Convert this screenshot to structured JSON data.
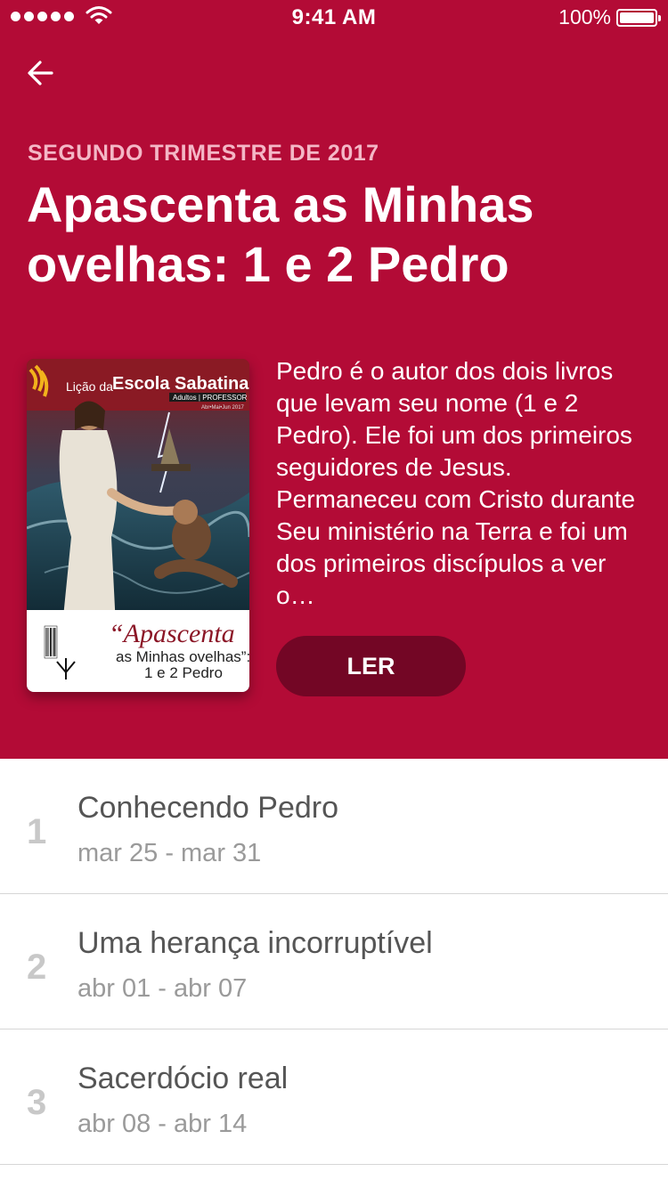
{
  "status_bar": {
    "time": "9:41 AM",
    "battery": "100%"
  },
  "quarter": {
    "eyebrow": "SEGUNDO TRIMESTRE DE 2017",
    "title": "Apascenta as Minhas ovelhas: 1 e 2 Pedro",
    "description": "Pedro é o autor dos dois livros que levam seu nome (1 e 2 Pedro). Ele foi um dos primeiros seguidores de Jesus. Permaneceu com Cristo durante Seu ministério na Terra e foi um dos primeiros discípulos a ver o…",
    "read_label": "LER"
  },
  "cover": {
    "header_small": "Lição da",
    "header_big": "Escola Sabatina",
    "subheader": "Adultos | PROFESSOR",
    "period": "Abr•Mai•Jun 2017",
    "quote_line1": "“Apascenta",
    "quote_line2": "as Minhas ovelhas”:",
    "quote_line3": "1 e 2 Pedro"
  },
  "lessons": [
    {
      "number": "1",
      "title": "Conhecendo Pedro",
      "dates": "mar 25 - mar 31"
    },
    {
      "number": "2",
      "title": "Uma herança incorruptível",
      "dates": "abr 01 - abr 07"
    },
    {
      "number": "3",
      "title": "Sacerdócio real",
      "dates": "abr 08 - abr 14"
    }
  ],
  "colors": {
    "header": "#b30b36",
    "button": "#730625",
    "eyebrow": "#f4b7c6"
  },
  "icons": [
    "signal-dots-icon",
    "wifi-icon",
    "battery-icon",
    "back-arrow-icon"
  ]
}
